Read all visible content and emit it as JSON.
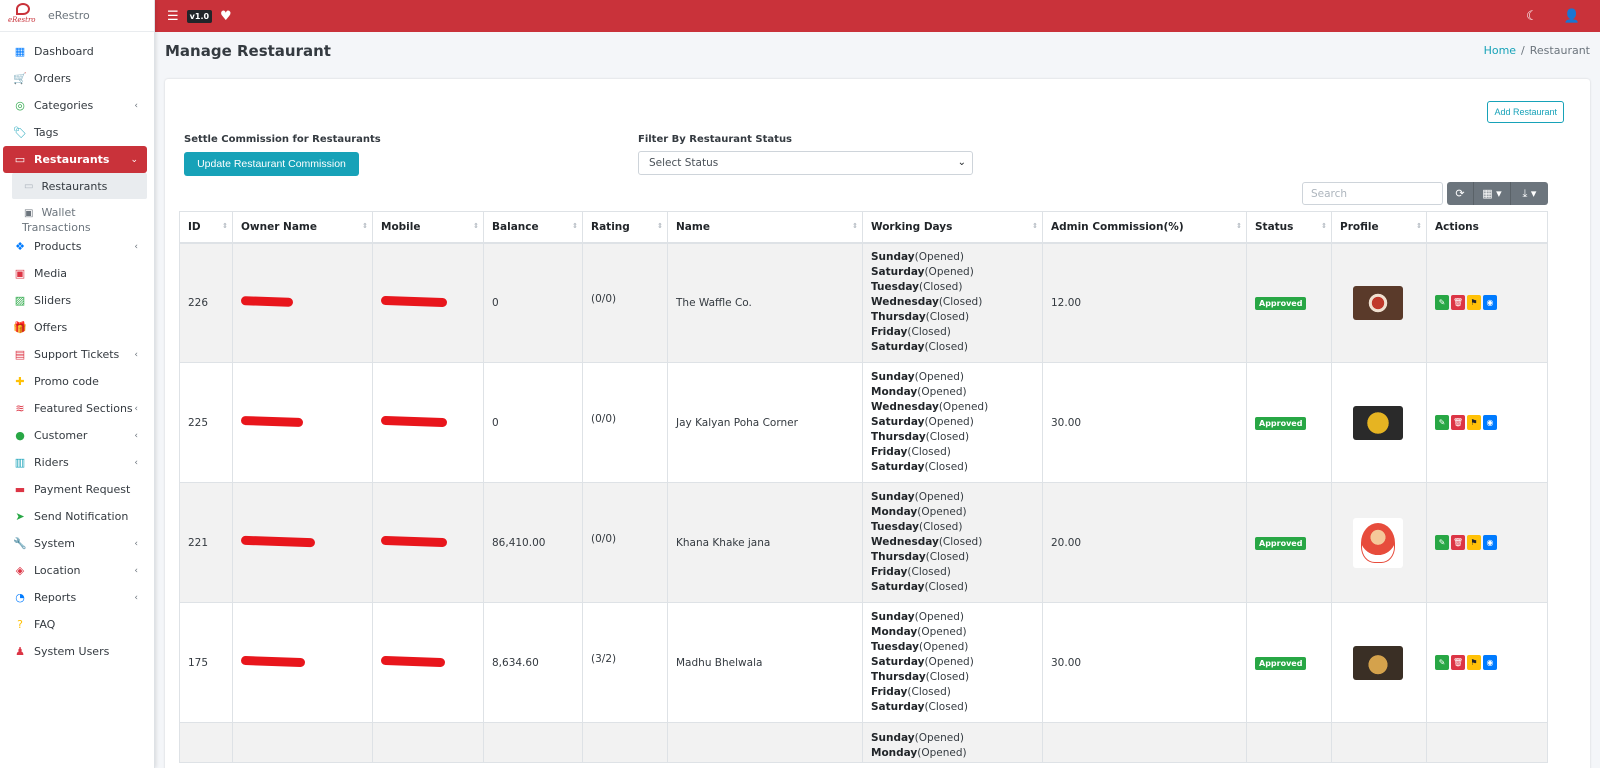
{
  "app": {
    "name": "eRestro",
    "logo_text": "eRestro",
    "version": "v1.0"
  },
  "sidebar": {
    "items": [
      {
        "label": "Dashboard",
        "icon": "dashboard-icon",
        "color": "#007bff",
        "chevron": false
      },
      {
        "label": "Orders",
        "icon": "cart-icon",
        "color": "#ffc107",
        "chevron": false
      },
      {
        "label": "Categories",
        "icon": "category-icon",
        "color": "#28a745",
        "chevron": true
      },
      {
        "label": "Tags",
        "icon": "tag-icon",
        "color": "#17a2b8",
        "chevron": false
      },
      {
        "label": "Restaurants",
        "icon": "store-icon",
        "color": "#ffffff",
        "chevron": true,
        "active": true
      },
      {
        "label": "Products",
        "icon": "cubes-icon",
        "color": "#007bff",
        "chevron": true
      },
      {
        "label": "Media",
        "icon": "media-icon",
        "color": "#dc3545",
        "chevron": false
      },
      {
        "label": "Sliders",
        "icon": "image-icon",
        "color": "#28a745",
        "chevron": false
      },
      {
        "label": "Offers",
        "icon": "gift-icon",
        "color": "#007bff",
        "chevron": false
      },
      {
        "label": "Support Tickets",
        "icon": "ticket-icon",
        "color": "#dc3545",
        "chevron": true
      },
      {
        "label": "Promo code",
        "icon": "puzzle-icon",
        "color": "#ffc107",
        "chevron": false
      },
      {
        "label": "Featured Sections",
        "icon": "layers-icon",
        "color": "#dc3545",
        "chevron": true
      },
      {
        "label": "Customer",
        "icon": "user-icon",
        "color": "#28a745",
        "chevron": true
      },
      {
        "label": "Riders",
        "icon": "id-card-icon",
        "color": "#17a2b8",
        "chevron": true
      },
      {
        "label": "Payment Request",
        "icon": "money-icon",
        "color": "#dc3545",
        "chevron": false
      },
      {
        "label": "Send Notification",
        "icon": "paper-plane-icon",
        "color": "#28a745",
        "chevron": false
      },
      {
        "label": "System",
        "icon": "wrench-icon",
        "color": "#007bff",
        "chevron": true
      },
      {
        "label": "Location",
        "icon": "map-icon",
        "color": "#dc3545",
        "chevron": true
      },
      {
        "label": "Reports",
        "icon": "chart-pie-icon",
        "color": "#007bff",
        "chevron": true
      },
      {
        "label": "FAQ",
        "icon": "question-icon",
        "color": "#ffc107",
        "chevron": false
      },
      {
        "label": "System Users",
        "icon": "user-shield-icon",
        "color": "#dc3545",
        "chevron": false
      }
    ],
    "sub_items": [
      {
        "label": "Restaurants"
      },
      {
        "label": "Wallet",
        "label2": "Transactions"
      }
    ]
  },
  "header": {
    "title": "Manage Restaurant"
  },
  "breadcrumb": {
    "home": "Home",
    "separator": "/",
    "current": "Restaurant"
  },
  "toolbar": {
    "add_label": "Add Restaurant",
    "settle_label": "Settle Commission for Restaurants",
    "update_label": "Update Restaurant Commission",
    "filter_label": "Filter By Restaurant Status",
    "select_value": "Select Status",
    "search_placeholder": "Search"
  },
  "table": {
    "columns": [
      "ID",
      "Owner Name",
      "Mobile",
      "Balance",
      "Rating",
      "Name",
      "Working Days",
      "Admin Commission(%)",
      "Status",
      "Profile",
      "Actions"
    ],
    "rows": [
      {
        "id": "226",
        "owner_redact": 52,
        "mobile_redact": 66,
        "balance": "0",
        "rating": "(0/0)",
        "name": "The Waffle Co.",
        "days": [
          [
            "Sunday",
            "(Opened)"
          ],
          [
            "Saturday",
            "(Opened)"
          ],
          [
            "Tuesday",
            "(Closed)"
          ],
          [
            "Wednesday",
            "(Closed)"
          ],
          [
            "Thursday",
            "(Closed)"
          ],
          [
            "Friday",
            "(Closed)"
          ],
          [
            "Saturday",
            "(Closed)"
          ]
        ],
        "commission": "12.00",
        "status": "Approved",
        "thumb": "t1"
      },
      {
        "id": "225",
        "owner_redact": 62,
        "mobile_redact": 66,
        "balance": "0",
        "rating": "(0/0)",
        "name": "Jay Kalyan Poha Corner",
        "days": [
          [
            "Sunday",
            "(Opened)"
          ],
          [
            "Monday",
            "(Opened)"
          ],
          [
            "Wednesday",
            "(Opened)"
          ],
          [
            "Saturday",
            "(Opened)"
          ],
          [
            "Thursday",
            "(Closed)"
          ],
          [
            "Friday",
            "(Closed)"
          ],
          [
            "Saturday",
            "(Closed)"
          ]
        ],
        "commission": "30.00",
        "status": "Approved",
        "thumb": "t2"
      },
      {
        "id": "221",
        "owner_redact": 74,
        "mobile_redact": 66,
        "balance": "86,410.00",
        "rating": "(0/0)",
        "name": "Khana Khake jana",
        "days": [
          [
            "Sunday",
            "(Opened)"
          ],
          [
            "Monday",
            "(Opened)"
          ],
          [
            "Tuesday",
            "(Closed)"
          ],
          [
            "Wednesday",
            "(Closed)"
          ],
          [
            "Thursday",
            "(Closed)"
          ],
          [
            "Friday",
            "(Closed)"
          ],
          [
            "Saturday",
            "(Closed)"
          ]
        ],
        "commission": "20.00",
        "status": "Approved",
        "thumb": "t3"
      },
      {
        "id": "175",
        "owner_redact": 64,
        "mobile_redact": 64,
        "balance": "8,634.60",
        "rating": "(3/2)",
        "name": "Madhu Bhelwala",
        "days": [
          [
            "Sunday",
            "(Opened)"
          ],
          [
            "Monday",
            "(Opened)"
          ],
          [
            "Tuesday",
            "(Opened)"
          ],
          [
            "Saturday",
            "(Opened)"
          ],
          [
            "Thursday",
            "(Closed)"
          ],
          [
            "Friday",
            "(Closed)"
          ],
          [
            "Saturday",
            "(Closed)"
          ]
        ],
        "commission": "30.00",
        "status": "Approved",
        "thumb": "t4"
      }
    ],
    "partial_row": {
      "days": [
        [
          "Sunday",
          "(Opened)"
        ],
        [
          "Monday",
          "(Opened)"
        ]
      ]
    }
  },
  "colors": {
    "brand": "#c9323a",
    "info": "#17a2b8",
    "success": "#28a745",
    "danger": "#dc3545",
    "warning": "#ffc107",
    "primary": "#007bff"
  }
}
